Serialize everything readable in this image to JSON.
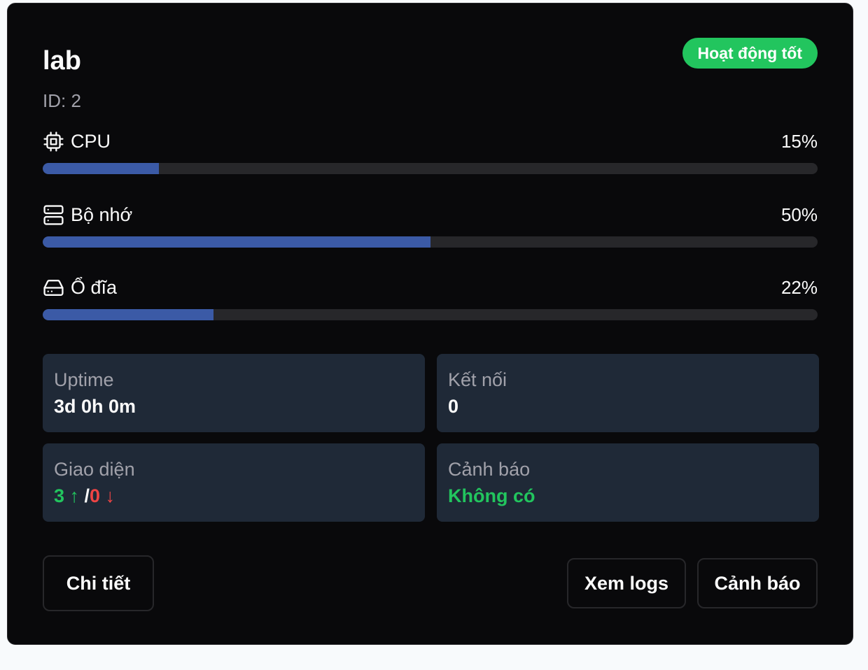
{
  "server": {
    "name": "lab",
    "id_label": "ID: 2",
    "status": "Hoạt động tốt",
    "status_color": "#22c55e"
  },
  "metrics": [
    {
      "label": "CPU",
      "value_text": "15%",
      "percent": 15,
      "icon": "cpu-icon"
    },
    {
      "label": "Bộ nhớ",
      "value_text": "50%",
      "percent": 50,
      "icon": "memory-icon"
    },
    {
      "label": "Ổ đĩa",
      "value_text": "22%",
      "percent": 22,
      "icon": "disk-icon"
    }
  ],
  "bar_color": "#3b5aa6",
  "stats": {
    "uptime": {
      "label": "Uptime",
      "value": "3d 0h 0m"
    },
    "connections": {
      "label": "Kết nối",
      "value": "0"
    },
    "interfaces": {
      "label": "Giao diện",
      "up": "3 ↑",
      "separator": " /",
      "down": "0 ↓"
    },
    "alerts": {
      "label": "Cảnh báo",
      "value": "Không có"
    }
  },
  "buttons": {
    "details": "Chi tiết",
    "logs": "Xem logs",
    "alerts": "Cảnh báo"
  }
}
